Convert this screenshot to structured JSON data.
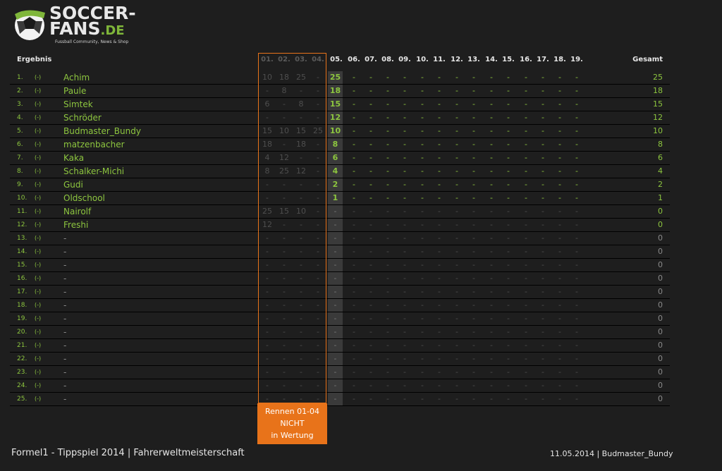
{
  "logo": {
    "line1": "SOCCER-",
    "line2": "FANS",
    "line2_suffix": ".DE",
    "tagline": "Fussball Community, News & Shop"
  },
  "table": {
    "title": "Ergebnis",
    "total_label": "Gesamt",
    "race_labels": [
      "01.",
      "02.",
      "03.",
      "04.",
      "05.",
      "06.",
      "07.",
      "08.",
      "09.",
      "10.",
      "11.",
      "12.",
      "13.",
      "14.",
      "15.",
      "16.",
      "17.",
      "18.",
      "19."
    ],
    "rows": [
      {
        "rank": "1.",
        "prev": "(-)",
        "name": "Achim",
        "old": [
          "10",
          "18",
          "25",
          "-"
        ],
        "r5": "25",
        "total": "25"
      },
      {
        "rank": "2.",
        "prev": "(-)",
        "name": "Paule",
        "old": [
          "-",
          "8",
          "-",
          "-"
        ],
        "r5": "18",
        "total": "18"
      },
      {
        "rank": "3.",
        "prev": "(-)",
        "name": "Simtek",
        "old": [
          "6",
          "-",
          "8",
          "-"
        ],
        "r5": "15",
        "total": "15"
      },
      {
        "rank": "4.",
        "prev": "(-)",
        "name": "Schröder",
        "old": [
          "-",
          "-",
          "-",
          "-"
        ],
        "r5": "12",
        "total": "12"
      },
      {
        "rank": "5.",
        "prev": "(-)",
        "name": "Budmaster_Bundy",
        "old": [
          "15",
          "10",
          "15",
          "25"
        ],
        "r5": "10",
        "total": "10"
      },
      {
        "rank": "6.",
        "prev": "(-)",
        "name": "matzenbacher",
        "old": [
          "18",
          "-",
          "18",
          "-"
        ],
        "r5": "8",
        "total": "8"
      },
      {
        "rank": "7.",
        "prev": "(-)",
        "name": "Kaka",
        "old": [
          "4",
          "12",
          "-",
          "-"
        ],
        "r5": "6",
        "total": "6"
      },
      {
        "rank": "8.",
        "prev": "(-)",
        "name": "Schalker-Michi",
        "old": [
          "8",
          "25",
          "12",
          "-"
        ],
        "r5": "4",
        "total": "4"
      },
      {
        "rank": "9.",
        "prev": "(-)",
        "name": "Gudi",
        "old": [
          "-",
          "-",
          "-",
          "-"
        ],
        "r5": "2",
        "total": "2"
      },
      {
        "rank": "10.",
        "prev": "(-)",
        "name": "Oldschool",
        "old": [
          "-",
          "-",
          "-",
          "-"
        ],
        "r5": "1",
        "total": "1"
      },
      {
        "rank": "11.",
        "prev": "(-)",
        "name": "Nairolf",
        "old": [
          "25",
          "15",
          "10",
          "-"
        ],
        "r5": "-",
        "total": "0"
      },
      {
        "rank": "12.",
        "prev": "(-)",
        "name": "Freshi",
        "old": [
          "12",
          "-",
          "-",
          "-"
        ],
        "r5": "-",
        "total": "0"
      },
      {
        "rank": "13.",
        "prev": "(-)",
        "name": "-",
        "old": [
          "-",
          "-",
          "-",
          "-"
        ],
        "r5": "-",
        "total": "0"
      },
      {
        "rank": "14.",
        "prev": "(-)",
        "name": "-",
        "old": [
          "-",
          "-",
          "-",
          "-"
        ],
        "r5": "-",
        "total": "0"
      },
      {
        "rank": "15.",
        "prev": "(-)",
        "name": "-",
        "old": [
          "-",
          "-",
          "-",
          "-"
        ],
        "r5": "-",
        "total": "0"
      },
      {
        "rank": "16.",
        "prev": "(-)",
        "name": "-",
        "old": [
          "-",
          "-",
          "-",
          "-"
        ],
        "r5": "-",
        "total": "0"
      },
      {
        "rank": "17.",
        "prev": "(-)",
        "name": "-",
        "old": [
          "-",
          "-",
          "-",
          "-"
        ],
        "r5": "-",
        "total": "0"
      },
      {
        "rank": "18.",
        "prev": "(-)",
        "name": "-",
        "old": [
          "-",
          "-",
          "-",
          "-"
        ],
        "r5": "-",
        "total": "0"
      },
      {
        "rank": "19.",
        "prev": "(-)",
        "name": "-",
        "old": [
          "-",
          "-",
          "-",
          "-"
        ],
        "r5": "-",
        "total": "0"
      },
      {
        "rank": "20.",
        "prev": "(-)",
        "name": "-",
        "old": [
          "-",
          "-",
          "-",
          "-"
        ],
        "r5": "-",
        "total": "0"
      },
      {
        "rank": "21.",
        "prev": "(-)",
        "name": "-",
        "old": [
          "-",
          "-",
          "-",
          "-"
        ],
        "r5": "-",
        "total": "0"
      },
      {
        "rank": "22.",
        "prev": "(-)",
        "name": "-",
        "old": [
          "-",
          "-",
          "-",
          "-"
        ],
        "r5": "-",
        "total": "0"
      },
      {
        "rank": "23.",
        "prev": "(-)",
        "name": "-",
        "old": [
          "-",
          "-",
          "-",
          "-"
        ],
        "r5": "-",
        "total": "0"
      },
      {
        "rank": "24.",
        "prev": "(-)",
        "name": "-",
        "old": [
          "-",
          "-",
          "-",
          "-"
        ],
        "r5": "-",
        "total": "0"
      },
      {
        "rank": "25.",
        "prev": "(-)",
        "name": "-",
        "old": [
          "-",
          "-",
          "-",
          "-"
        ],
        "r5": "-",
        "total": "0"
      }
    ],
    "future_cell": "-"
  },
  "notice": {
    "line1": "Rennen 01-04",
    "line2": "NICHT",
    "line3": "in Wertung"
  },
  "footer": {
    "left": "Formel1 - Tippspiel 2014  |  Fahrerweltmeisterschaft",
    "right": "11.05.2014 | Budmaster_Bundy"
  },
  "colors": {
    "background": "#1e1e1e",
    "accent_green": "#8dc63f",
    "accent_orange": "#e8731a"
  }
}
